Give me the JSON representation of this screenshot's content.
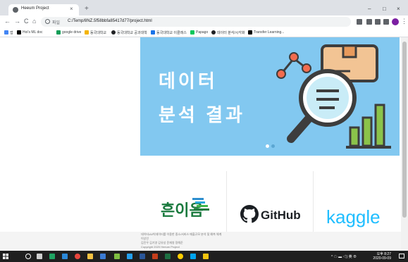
{
  "browser": {
    "tab_title": "Heeum Project",
    "tab_close": "×",
    "new_tab": "+",
    "window_controls": [
      "–",
      "□",
      "×"
    ],
    "nav": {
      "back": "←",
      "forward": "→",
      "reload": "C",
      "home": "⌂"
    },
    "address": {
      "secure_label": "파일",
      "url": "C:/Temp/8NZ.5f58bbfa85417d77/project.html"
    },
    "bookmarks": [
      {
        "label": "앱",
        "color": "#4285f4"
      },
      {
        "label": "Hoi's ML doc",
        "color": "#000000"
      },
      {
        "label": "google drive",
        "color": "#0f9d58"
      },
      {
        "label": "동국대학교",
        "color": "#f4b400"
      },
      {
        "label": "동국대학교 공과대학",
        "color": "#202124"
      },
      {
        "label": "동국대학교 이클래스",
        "color": "#1a73e8"
      },
      {
        "label": "Papago",
        "color": "#03c75a"
      },
      {
        "label": "데이터 분석/시각화",
        "color": "#202124"
      },
      {
        "label": "Transfer Learning...",
        "color": "#000000"
      }
    ]
  },
  "page": {
    "banner": {
      "line1": "데이터",
      "line2": "분석 결과",
      "background": "#82c8f0"
    },
    "logos": {
      "heeum": "흔이음",
      "github": "GitHub",
      "kaggle": "kaggle"
    },
    "footer": {
      "line1": "데이터/AI/빅데이터를 이용한 중소/서비스 매출규모 분석 및 예측 체계",
      "line2": "이상인",
      "line3": "김진우 김기영 김유성 윤재영 정해준",
      "line4": "Copyright 2020 Heeum Project"
    }
  },
  "taskbar": {
    "time": "오후 8:27",
    "date": "2020-09-09",
    "tray": "^ ☁ ▬ ◁) 英 ⊕"
  }
}
